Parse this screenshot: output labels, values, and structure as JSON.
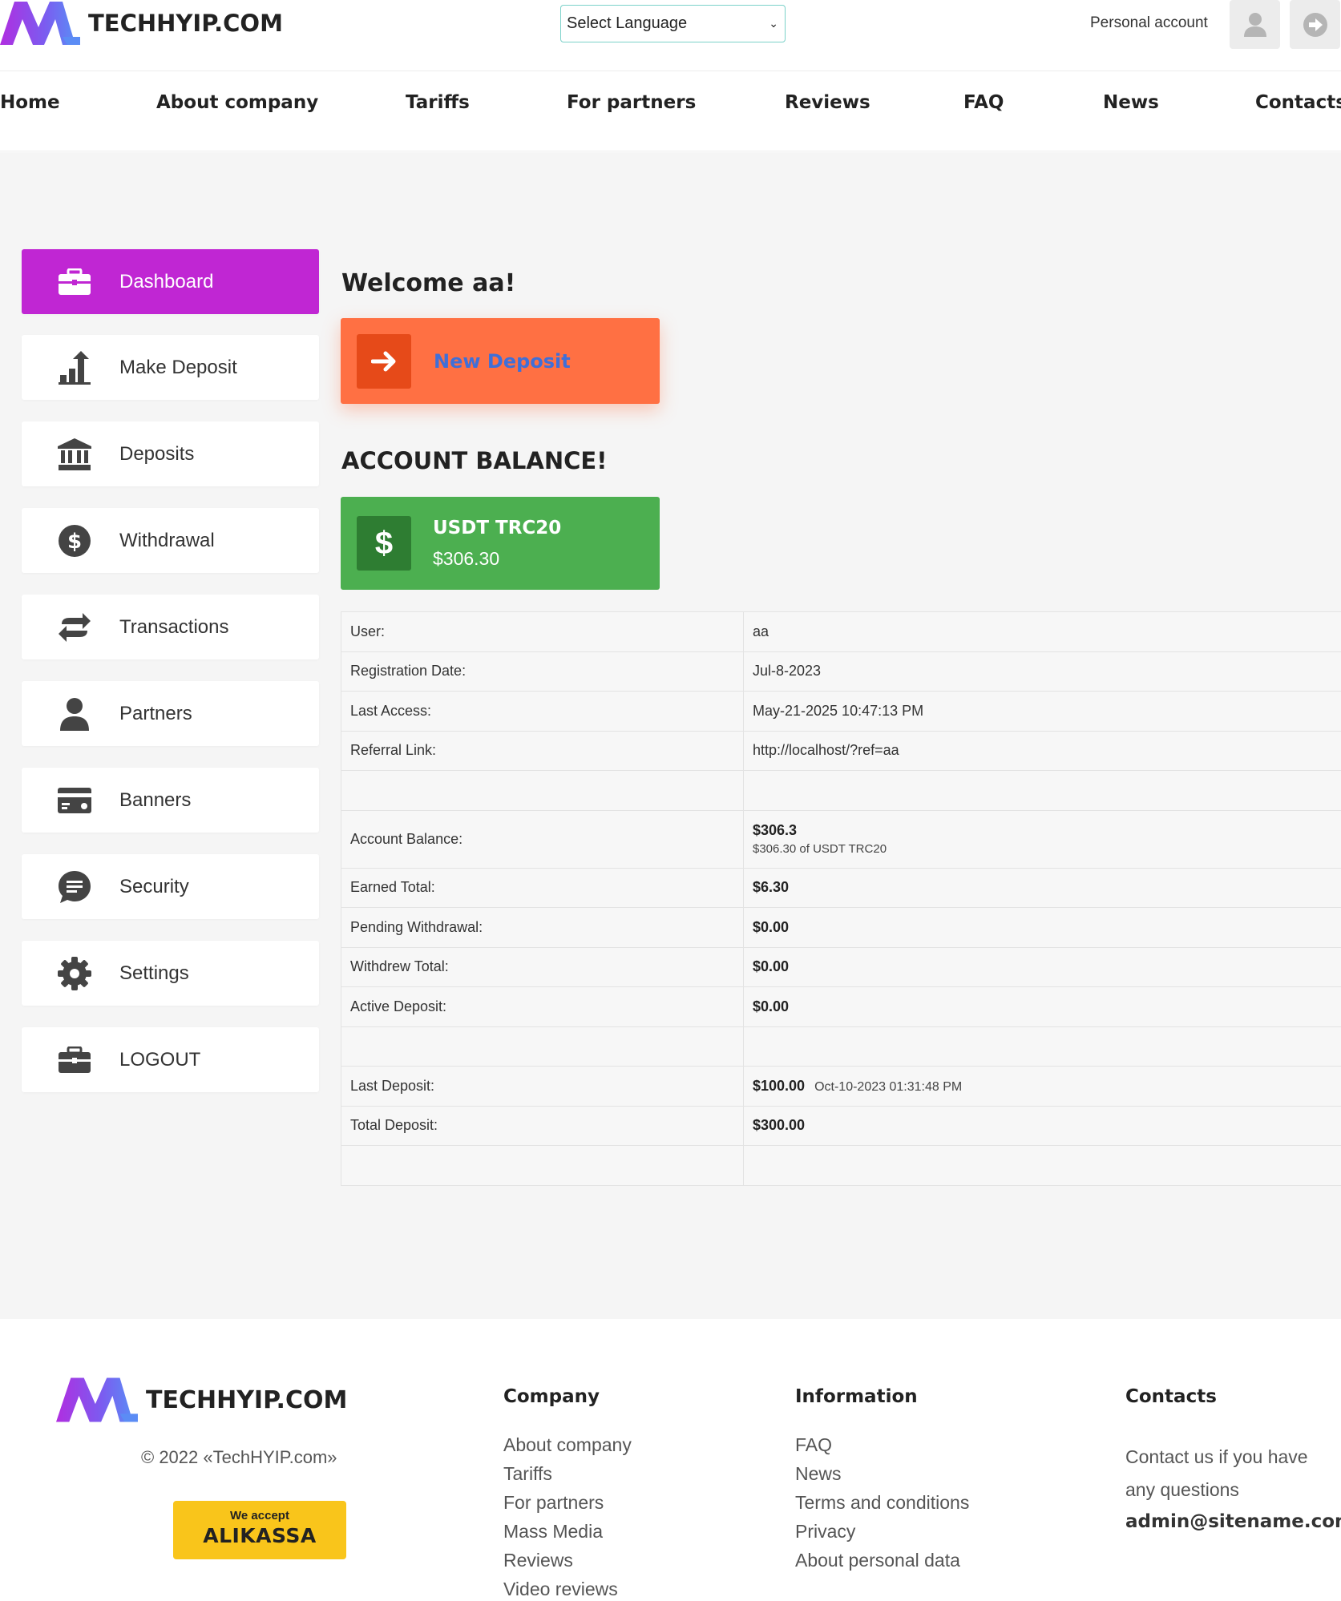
{
  "header": {
    "brand": "TECHHYIP.COM",
    "language_select": "Select Language",
    "personal_account": "Personal account"
  },
  "nav": {
    "items": [
      "Home",
      "About company",
      "Tariffs",
      "For partners",
      "Reviews",
      "FAQ",
      "News",
      "Contacts"
    ]
  },
  "sidebar": {
    "items": [
      {
        "label": "Dashboard",
        "icon": "briefcase-icon"
      },
      {
        "label": "Make Deposit",
        "icon": "chart-up-icon"
      },
      {
        "label": "Deposits",
        "icon": "bank-icon"
      },
      {
        "label": "Withdrawal",
        "icon": "dollar-coin-icon"
      },
      {
        "label": "Transactions",
        "icon": "exchange-icon"
      },
      {
        "label": "Partners",
        "icon": "user-icon"
      },
      {
        "label": "Banners",
        "icon": "card-icon"
      },
      {
        "label": "Security",
        "icon": "chat-icon"
      },
      {
        "label": "Settings",
        "icon": "gear-icon"
      },
      {
        "label": "LOGOUT",
        "icon": "briefcase-icon"
      }
    ]
  },
  "main": {
    "welcome": "Welcome aa!",
    "new_deposit": "New Deposit",
    "account_balance_title": "ACCOUNT BALANCE!",
    "balance_card": {
      "currency": "USDT TRC20",
      "amount": "$306.30"
    },
    "table": {
      "user_label": "User:",
      "user_value": "aa",
      "reg_label": "Registration Date:",
      "reg_value": "Jul-8-2023",
      "last_access_label": "Last Access:",
      "last_access_value": "May-21-2025 10:47:13 PM",
      "ref_label": "Referral Link:",
      "ref_value": "http://localhost/?ref=aa",
      "balance_label": "Account Balance:",
      "balance_value": "$306.3",
      "balance_sub": "$306.30 of USDT TRC20",
      "earned_label": "Earned Total:",
      "earned_value": "$6.30",
      "pending_label": "Pending Withdrawal:",
      "pending_value": "$0.00",
      "withdrew_label": "Withdrew Total:",
      "withdrew_value": "$0.00",
      "active_label": "Active Deposit:",
      "active_value": "$0.00",
      "last_dep_label": "Last Deposit:",
      "last_dep_value": "$100.00",
      "last_dep_date": "Oct-10-2023 01:31:48 PM",
      "total_dep_label": "Total Deposit:",
      "total_dep_value": "$300.00"
    }
  },
  "footer": {
    "brand": "TECHHYIP.COM",
    "copyright": "© 2022 «TechHYIP.com»",
    "alikassa_top": "We accept",
    "alikassa_main": "ALIKASSA",
    "company_title": "Company",
    "company_links": [
      "About company",
      "Tariffs",
      "For partners",
      "Mass Media",
      "Reviews",
      "Video reviews"
    ],
    "info_title": "Information",
    "info_links": [
      "FAQ",
      "News",
      "Terms and conditions",
      "Privacy",
      "About personal data"
    ],
    "contacts_title": "Contacts",
    "contacts_text": "Contact us if you have any questions",
    "email": "admin@sitename.com"
  },
  "colors": {
    "accent_purple": "#c026d3",
    "deposit_orange": "#ff7043",
    "balance_green": "#4caf50"
  }
}
